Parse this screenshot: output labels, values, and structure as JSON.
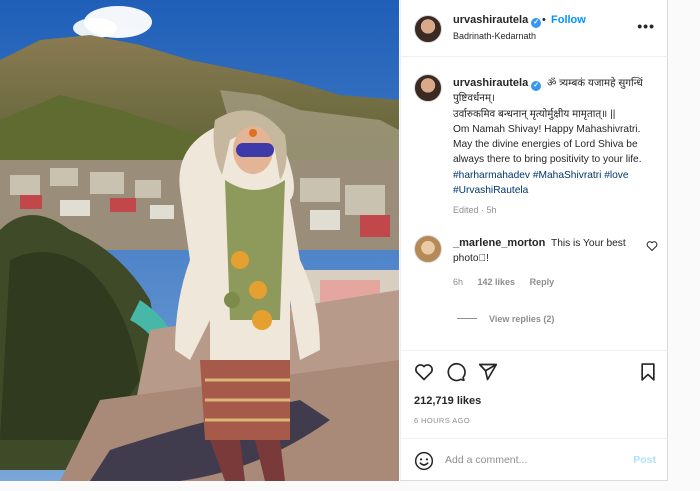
{
  "post": {
    "username": "urvashirautela",
    "follow_label": "Follow",
    "separator": "•",
    "location": "Badrinath-Kedarnath",
    "more_label": "•••"
  },
  "caption": {
    "username": "urvashirautela",
    "text": "ॐ त्र्यम्बकं यजामहे सुगन्धिं पुष्टिवर्धनम्।\nउर्वारुकमिव बन्धनान् मृत्योर्मुक्षीय मामृतात्॥ ||\nOm Namah Shivay! Happy Mahashivratri. May the divine energies of Lord Shiva be always there to bring positivity to your life.",
    "hashtags": "#harharmahadev #MahaShivratri #love #UrvashiRautela",
    "edited": "Edited · 5h"
  },
  "comment": {
    "username": "_marlene_morton",
    "text": "This is Your best photo􏿾!",
    "time": "6h",
    "likes": "142 likes",
    "reply_label": "Reply",
    "view_replies": "View replies (2)"
  },
  "stats": {
    "likes": "212,719 likes",
    "time_ago": "6 HOURS AGO"
  },
  "composer": {
    "placeholder": "Add a comment...",
    "post_label": "Post"
  },
  "icons": [
    "heart-icon",
    "comment-icon",
    "share-icon",
    "bookmark-icon",
    "emoji-icon",
    "verified-badge-icon",
    "more-icon"
  ],
  "colors": {
    "accent": "#0095f6",
    "post_disabled": "#b2dffc",
    "hashtag": "#00376b",
    "muted": "#8e8e8e",
    "verified": "#3897f0"
  }
}
